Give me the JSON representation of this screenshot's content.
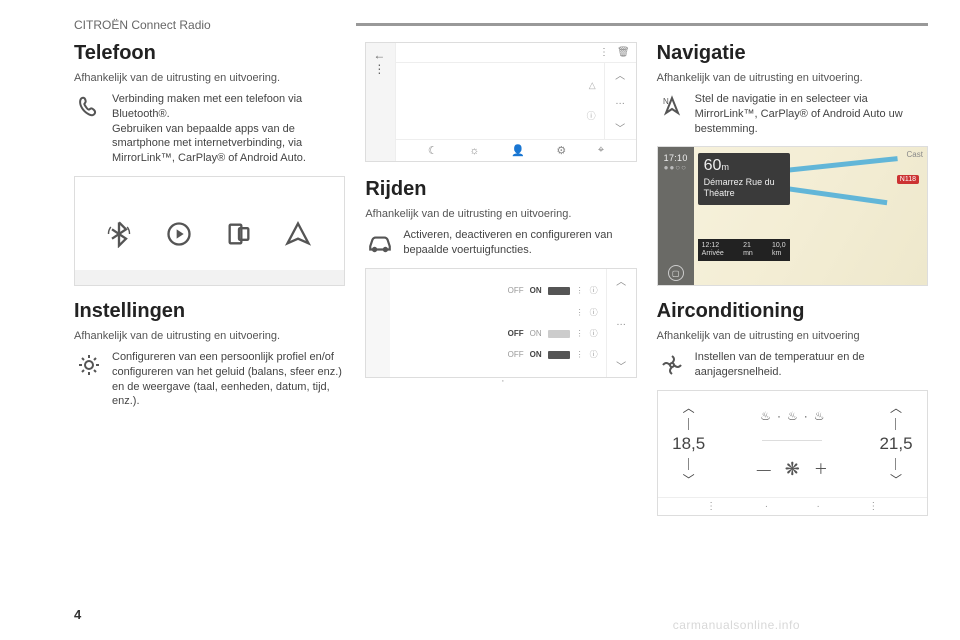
{
  "header": "CITROËN Connect Radio",
  "page_number": "4",
  "watermark": "carmanualsonline.info",
  "depends_line": "Afhankelijk van de uitrusting en uitvoering.",
  "depends_line_noperiod": "Afhankelijk van de uitrusting en uitvoering",
  "telefoon": {
    "title": "Telefoon",
    "desc": "Verbinding maken met een telefoon via Bluetooth®.\nGebruiken van bepaalde apps van de smartphone met internetverbinding, via MirrorLink™, CarPlay® of Android Auto."
  },
  "instellingen": {
    "title": "Instellingen",
    "desc": "Configureren van een persoonlijk profiel en/of configureren van het geluid (balans, sfeer enz.) en de weergave (taal, eenheden, datum, tijd, enz.)."
  },
  "rijden": {
    "title": "Rijden",
    "desc": "Activeren, deactiveren en configureren van bepaalde voertuigfuncties."
  },
  "navigatie": {
    "title": "Navigatie",
    "desc": "Stel de navigatie in en selecteer via MirrorLink™, CarPlay® of Android Auto uw bestemming.",
    "clock": "17:10",
    "dist_num": "60",
    "dist_unit": "m",
    "street": "Démarrez Rue du Théatre",
    "eta_time": "12:12",
    "eta_time_label": "Arrivée",
    "eta_min": "21",
    "eta_min_label": "mn",
    "eta_km": "10,0",
    "eta_km_label": "km",
    "road_badge": "N118",
    "cast": "Cast"
  },
  "airco": {
    "title": "Airconditioning",
    "desc": "Instellen van de temperatuur en de aanjagersnelheid.",
    "left_temp": "18,5",
    "right_temp": "21,5"
  },
  "toggles": {
    "off": "OFF",
    "on": "ON"
  },
  "glyphs": {
    "ellipsis": "…",
    "dot": "·",
    "minus": "—",
    "plus": "＋",
    "fan": "❋",
    "seat": "♨",
    "info": "ⓘ"
  }
}
